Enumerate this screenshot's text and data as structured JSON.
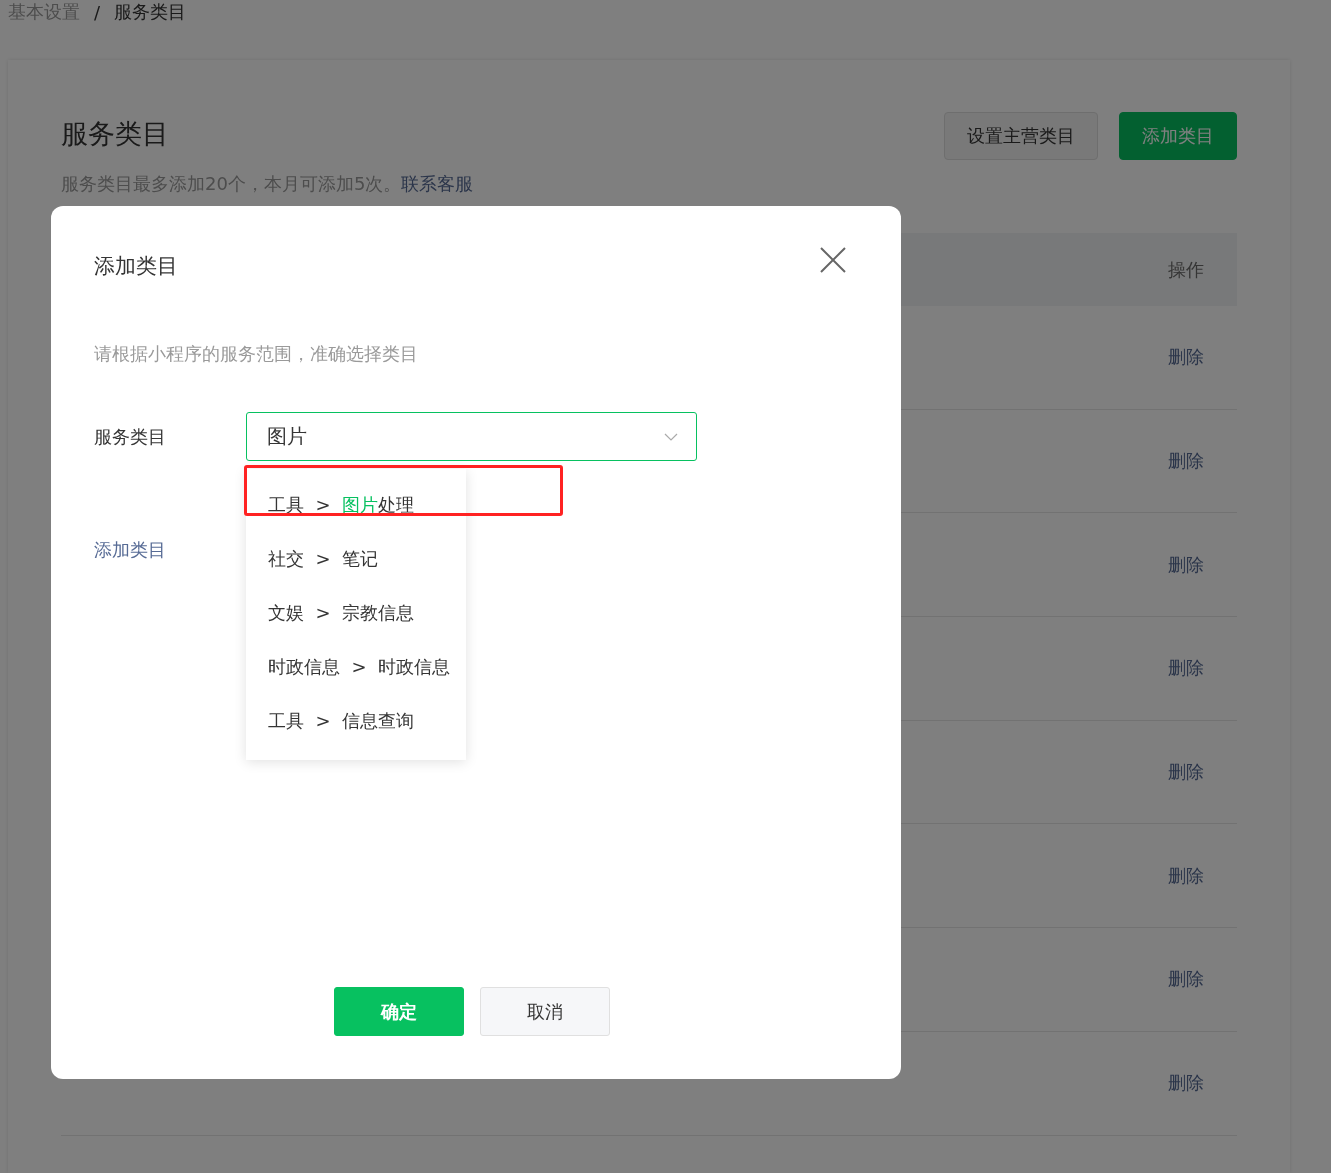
{
  "breadcrumb": [
    {
      "label": "基本设置",
      "current": false
    },
    {
      "label": "服务类目",
      "current": true
    }
  ],
  "breadcrumb_separator": "/",
  "page": {
    "title": "服务类目",
    "note": "服务类目最多添加20个，本月可添加5次。",
    "note_link": "联系客服",
    "buttons": [
      {
        "label": "设置主营类目",
        "primary": false
      },
      {
        "label": "添加类目",
        "primary": true
      }
    ]
  },
  "table": {
    "action_header": "操作",
    "rows": [
      {
        "action": "删除"
      },
      {
        "action": "删除"
      },
      {
        "action": "删除"
      },
      {
        "action": "删除"
      },
      {
        "action": "删除"
      },
      {
        "action": "删除"
      },
      {
        "action": "删除"
      },
      {
        "action": "删除"
      }
    ]
  },
  "dialog": {
    "option_separator": ">",
    "title": "添加类目",
    "hint": "请根据小程序的服务范围，准确选择类目",
    "field_label": "服务类目",
    "field_value": "图片",
    "add_link": "添加类目",
    "options": [
      {
        "parent": "工具",
        "child_parts": [
          {
            "text": "图片",
            "match": true
          },
          {
            "text": "处理",
            "match": false
          }
        ],
        "highlighted": true
      },
      {
        "parent": "社交",
        "child_parts": [
          {
            "text": "笔记",
            "match": false
          }
        ],
        "highlighted": false
      },
      {
        "parent": "文娱",
        "child_parts": [
          {
            "text": "宗教信息",
            "match": false
          }
        ],
        "highlighted": false
      },
      {
        "parent": "时政信息",
        "child_parts": [
          {
            "text": "时政信息",
            "match": false
          }
        ],
        "highlighted": false
      },
      {
        "parent": "工具",
        "child_parts": [
          {
            "text": "信息查询",
            "match": false
          }
        ],
        "highlighted": false
      }
    ],
    "buttons": [
      {
        "label": "确定",
        "primary": true
      },
      {
        "label": "取消",
        "primary": false
      }
    ]
  }
}
